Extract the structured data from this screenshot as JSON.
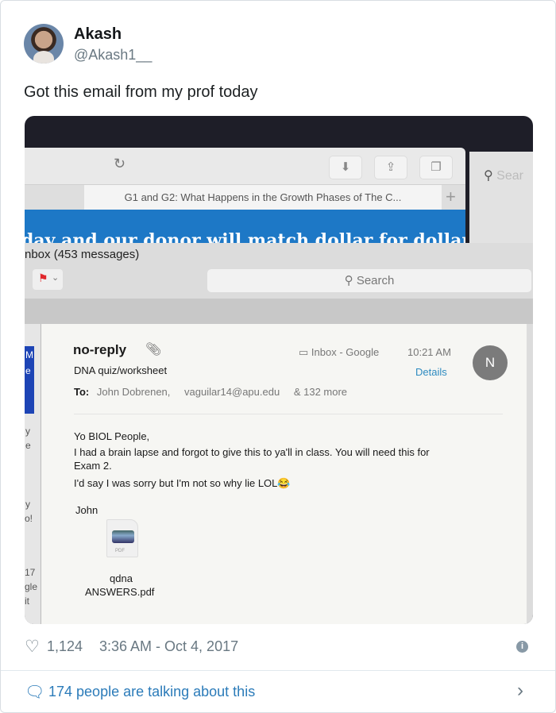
{
  "author": {
    "name": "Akash",
    "handle": "@Akash1__"
  },
  "tweet": {
    "text": "Got this email from my prof today"
  },
  "photo": {
    "browser": {
      "tab_title": "G1 and G2: What Happens in the Growth Phases of The C...",
      "banner_text": "day and our donor will match dollar for dollar",
      "search_placeholder": "Sear"
    },
    "mail": {
      "window_title": "nbox (453 messages)",
      "search_placeholder": "Search",
      "sidebar_fragments": [
        "M",
        "e",
        "y",
        "e",
        "y",
        "o!",
        "17",
        "gle",
        "it"
      ],
      "sender": "no-reply",
      "mailbox": "Inbox - Google",
      "time": "10:21 AM",
      "subject": "DNA quiz/worksheet",
      "details_label": "Details",
      "avatar_initial": "N",
      "to_label": "To:",
      "recipients": [
        "John Dobrenen,",
        "vaguilar14@apu.edu",
        "& 132 more"
      ],
      "body": [
        "Yo BIOL People,",
        "I had a brain lapse and forgot to give this to ya'll in class. You will need this for",
        "Exam 2.",
        "I'd say I was sorry but I'm not so why lie LOL😂",
        "John"
      ],
      "attachment": {
        "type_label": "PDF",
        "name_line1": "qdna",
        "name_line2": "ANSWERS.pdf"
      }
    }
  },
  "footer": {
    "likes": "1,124",
    "timestamp": "3:36 AM - Oct 4, 2017",
    "talking": "174 people are talking about this"
  },
  "colors": {
    "link": "#2b7bb9",
    "banner": "#1d78c6",
    "flag": "#e0262b"
  }
}
